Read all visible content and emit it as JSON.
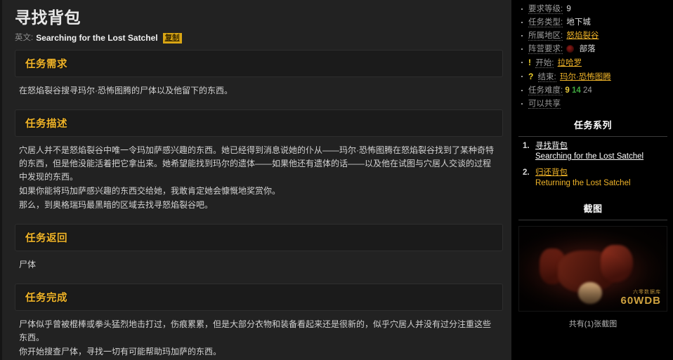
{
  "quest": {
    "title_cn": "寻找背包",
    "english_label": "英文:",
    "title_en": "Searching for the Lost Satchel",
    "copy_label": "复制"
  },
  "sections": [
    {
      "heading": "任务需求",
      "paragraphs": [
        "在怒焰裂谷搜寻玛尔·恐怖图腾的尸体以及他留下的东西。"
      ]
    },
    {
      "heading": "任务描述",
      "paragraphs": [
        "穴居人并不是怒焰裂谷中唯一令玛加萨感兴趣的东西。她已经得到消息说她的仆从——玛尔·恐怖图腾在怒焰裂谷找到了某种奇特的东西，但是他没能活着把它拿出来。她希望能找到玛尔的遗体——如果他还有遗体的话——以及他在试图与穴居人交谈的过程中发现的东西。",
        "如果你能将玛加萨感兴趣的东西交给她，我敢肯定她会慷慨地奖赏你。",
        "那么，到奥格瑞玛最黑暗的区域去找寻怒焰裂谷吧。"
      ]
    },
    {
      "heading": "任务返回",
      "paragraphs": [
        "尸体"
      ]
    },
    {
      "heading": "任务完成",
      "paragraphs": [
        "尸体似乎曾被棍棒或拳头猛烈地击打过，伤痕累累，但是大部分衣物和装备看起来还是很新的，似乎穴居人并没有过分注重这些东西。",
        "你开始搜查尸体，寻找一切有可能帮助玛加萨的东西。"
      ]
    }
  ],
  "sidebar": {
    "facts": [
      {
        "label": "要求等级:",
        "value": "9"
      },
      {
        "label": "任务类型:",
        "value": "地下城"
      },
      {
        "label": "所属地区:",
        "value": "怒焰裂谷"
      },
      {
        "label": "阵营要求:",
        "value": "部落"
      },
      {
        "label": "开始:",
        "value": "拉哈罗"
      },
      {
        "label": "结束:",
        "value": "玛尔·恐怖图腾"
      },
      {
        "label": "任务难度:",
        "value": "9 14 24"
      },
      {
        "label": "可以共享",
        "value": ""
      }
    ],
    "difficulty": {
      "low": "9",
      "mid": "14",
      "high": "24"
    },
    "series_heading": "任务系列",
    "series": [
      {
        "cn": "寻找背包",
        "en": "Searching for the Lost Satchel"
      },
      {
        "cn": "归还背包",
        "en": "Returning the Lost Satchel"
      }
    ],
    "screenshot_heading": "截图",
    "screenshot_caption": "共有(1)张截图",
    "watermark_cn": "六零数据库",
    "watermark_en": "60WDB"
  },
  "colors": {
    "gold": "#f0b429",
    "panel": "#1b1b1b",
    "main_bg": "#222222",
    "sidebar_bg": "#000000"
  }
}
